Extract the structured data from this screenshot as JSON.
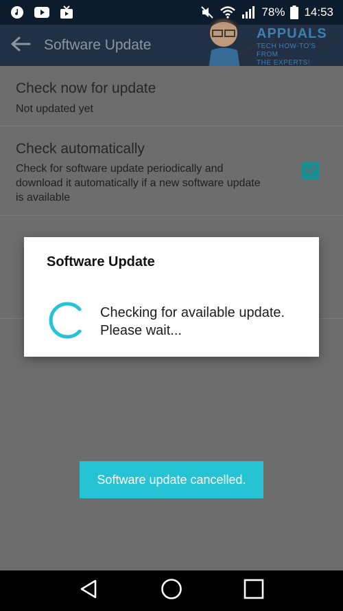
{
  "status_bar": {
    "battery": "78%",
    "time": "14:53"
  },
  "app_bar": {
    "title": "Software Update"
  },
  "watermark": {
    "brand": "APPUALS",
    "tagline_1": "TECH HOW-TO'S FROM",
    "tagline_2": "THE EXPERTS!"
  },
  "settings": {
    "check_now": {
      "title": "Check now for update",
      "subtitle": "Not updated yet"
    },
    "check_auto": {
      "title": "Check automatically",
      "subtitle": "Check for software update periodically and download it automatically if a new software update is available",
      "checked": true
    }
  },
  "dialog": {
    "title": "Software Update",
    "message": "Checking for available update. Please wait..."
  },
  "toast": {
    "text": "Software update cancelled."
  },
  "colors": {
    "accent": "#26c3d4",
    "app_bar": "#213044",
    "status_bar": "#0d1c2c"
  }
}
